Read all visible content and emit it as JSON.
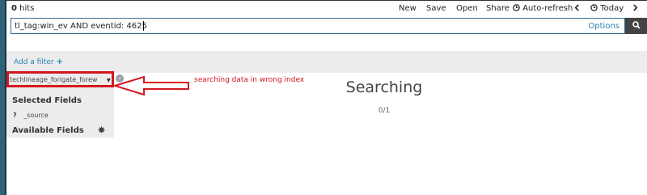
{
  "hits_label": "hits",
  "hits_count": "0",
  "menu": {
    "new": "New",
    "save": "Save",
    "open": "Open",
    "share": "Share",
    "auto_refresh": "Auto-refresh",
    "today": "Today"
  },
  "icons": {
    "clock": "clock-icon",
    "chevron_left": "chevron-left-icon",
    "chevron_right": "chevron-right-icon",
    "search": "search-icon",
    "gear": "gear-icon",
    "caret_down": "caret-down-icon",
    "collapse": "chevron-left-circle-icon"
  },
  "search": {
    "query": "tl_tag:win_ev AND eventid: 4625",
    "options_label": "Options"
  },
  "filter": {
    "add_label": "Add a filter"
  },
  "sidebar": {
    "index_pattern": "techlineage_forigate_forew",
    "selected_fields_title": "Selected Fields",
    "source_type": "?",
    "source_field": "_source",
    "available_fields_title": "Available Fields"
  },
  "annotation": {
    "text": "searching data in wrong index"
  },
  "main": {
    "status": "Searching",
    "progress": "0/1"
  },
  "colors": {
    "accent": "#2a7fb6",
    "annotation_red": "#d4181f",
    "sidebar_bg": "#ececec",
    "left_nav": "#2f6177"
  }
}
